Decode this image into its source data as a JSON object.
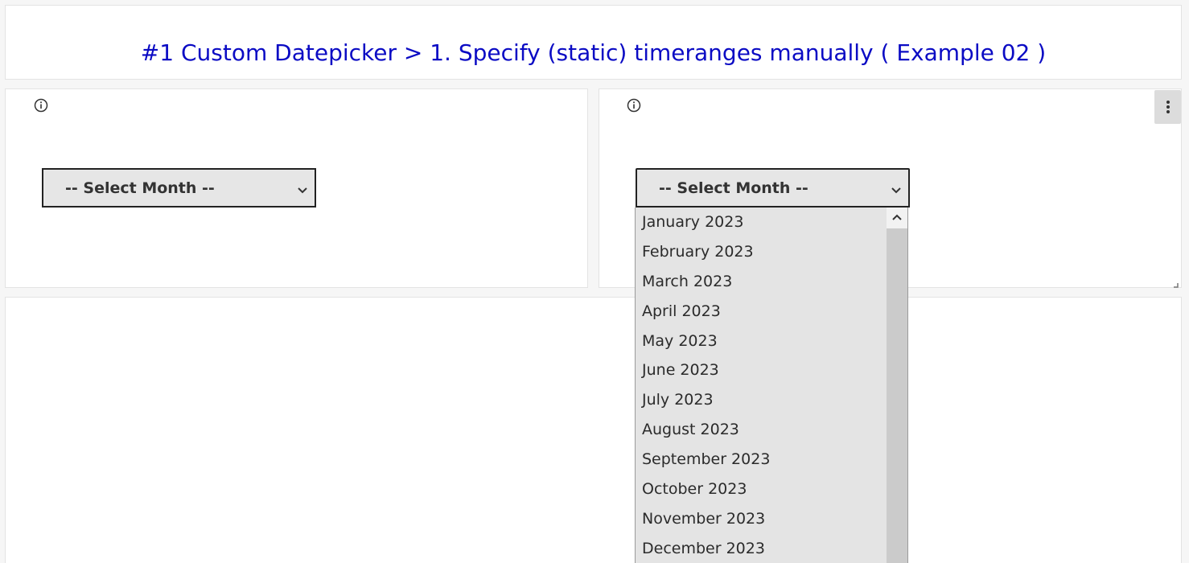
{
  "header": {
    "title": "#1 Custom Datepicker > 1. Specify (static) timeranges manually ( Example 02 )"
  },
  "left_panel": {
    "icon": "info-icon",
    "select": {
      "selected_label": "-- Select Month --",
      "icon": "chevron-down-icon"
    }
  },
  "right_panel": {
    "icon": "info-icon",
    "menu_icon": "vertical-dots-icon",
    "select": {
      "selected_label": "-- Select Month --",
      "icon": "chevron-down-icon",
      "open": true,
      "options": [
        "January 2023",
        "February 2023",
        "March 2023",
        "April 2023",
        "May 2023",
        "June 2023",
        "July 2023",
        "August 2023",
        "September 2023",
        "October 2023",
        "November 2023",
        "December 2023"
      ]
    }
  },
  "colors": {
    "title": "#0b0bc4",
    "select_background": "#e6e6e6",
    "dropdown_background": "#e4e4e4",
    "scrollbar_track": "#cbcbcb"
  }
}
